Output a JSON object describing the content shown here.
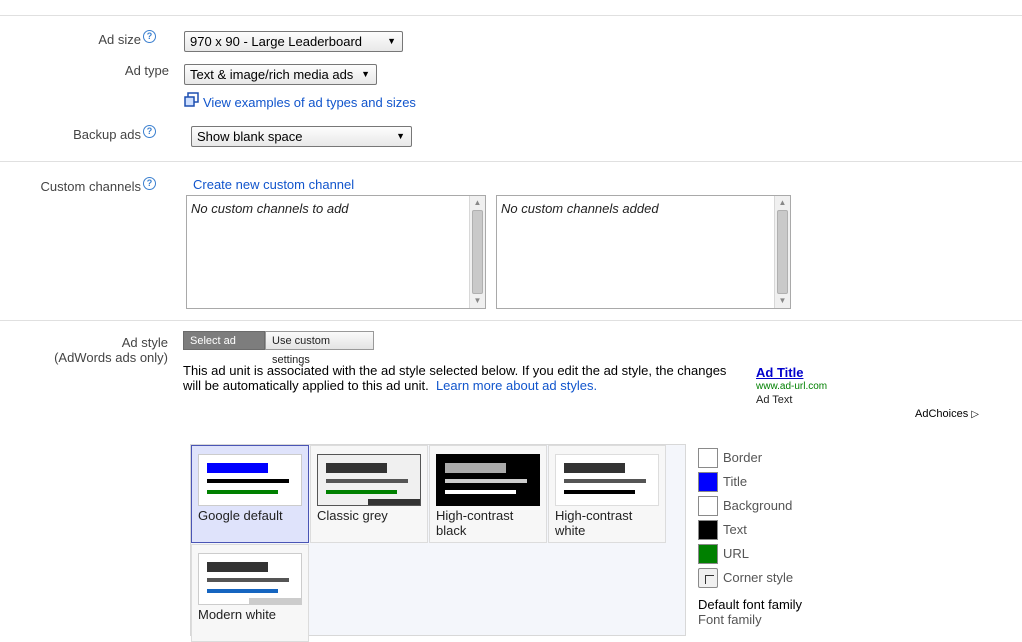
{
  "ad_size": {
    "label": "Ad size",
    "help": "?",
    "value": "970 x 90 - Large Leaderboard"
  },
  "ad_type": {
    "label": "Ad type",
    "value": "Text & image/rich media ads",
    "examples_link": "View examples of ad types and sizes"
  },
  "backup_ads": {
    "label": "Backup ads",
    "help": "?",
    "value": "Show blank space"
  },
  "custom_channels": {
    "label": "Custom channels",
    "help": "?",
    "create_link": "Create new custom channel",
    "available_text": "No custom channels to add",
    "added_text": "No custom channels added"
  },
  "ad_style": {
    "label": "Ad style",
    "sublabel": "(AdWords ads only)",
    "tabs": [
      "Select ad style",
      "Use custom settings"
    ],
    "description": "This ad unit is associated with the ad style selected below. If you edit the ad style, the changes",
    "description2": "will be automatically applied to this ad unit.",
    "learn_more": "Learn more about ad styles.",
    "preview": {
      "title": "Ad Title",
      "url": "www.ad-url.com",
      "text": "Ad Text",
      "adchoices": "AdChoices"
    },
    "styles": [
      {
        "name": "Google default"
      },
      {
        "name": "Classic grey"
      },
      {
        "name": "High-contrast black"
      },
      {
        "name": "High-contrast white"
      },
      {
        "name": "Modern white"
      }
    ],
    "swatches": [
      {
        "label": "Border",
        "color": "#ffffff"
      },
      {
        "label": "Title",
        "color": "#0000ff"
      },
      {
        "label": "Background",
        "color": "#ffffff"
      },
      {
        "label": "Text",
        "color": "#000000"
      },
      {
        "label": "URL",
        "color": "#008000"
      },
      {
        "label": "Corner style",
        "color": "#f0f0f0"
      }
    ],
    "font_heading": "Default font family",
    "font_sub": "Font family"
  }
}
